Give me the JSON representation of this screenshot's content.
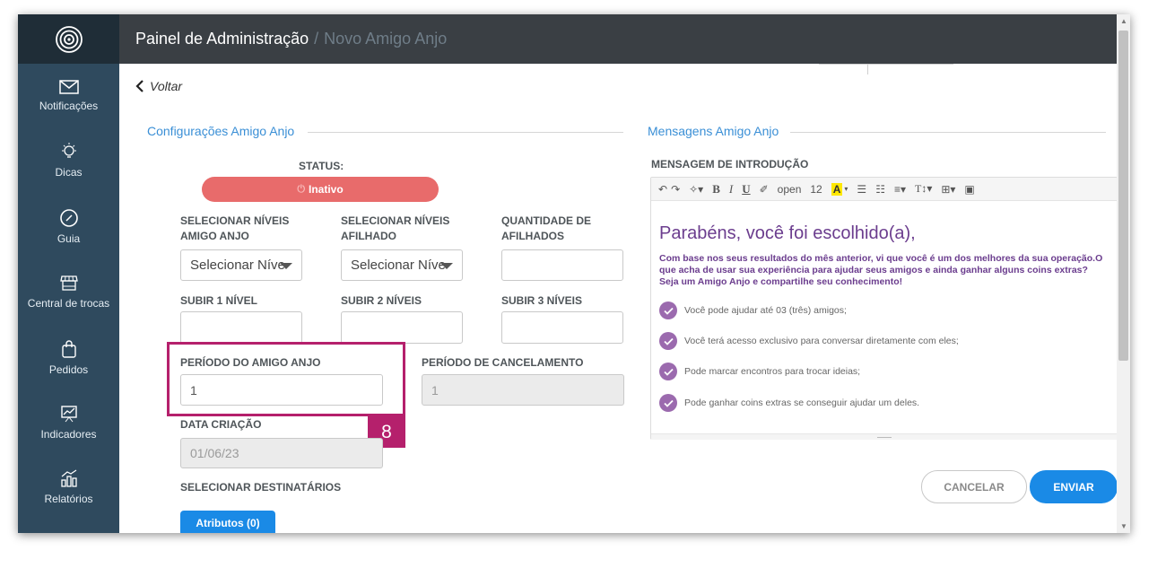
{
  "header": {
    "title": "Painel de Administração",
    "separator": "/",
    "subtitle": "Novo Amigo Anjo"
  },
  "sidebar": {
    "items": [
      {
        "label": "Notificações",
        "icon": "envelope-icon"
      },
      {
        "label": "Dicas",
        "icon": "lightbulb-icon"
      },
      {
        "label": "Guia",
        "icon": "compass-icon"
      },
      {
        "label": "Central de trocas",
        "icon": "store-icon"
      },
      {
        "label": "Pedidos",
        "icon": "shopping-bag-icon"
      },
      {
        "label": "Indicadores",
        "icon": "chart-board-icon"
      },
      {
        "label": "Relatórios",
        "icon": "bar-chart-icon"
      }
    ]
  },
  "nav": {
    "back_label": "Voltar"
  },
  "config": {
    "section_title": "Configurações Amigo Anjo",
    "status_label": "STATUS:",
    "status_value": "Inativo",
    "levels_angel_label": "SELECIONAR NÍVEIS AMIGO ANJO",
    "levels_angel_value": "Selecionar Níve",
    "levels_godchild_label": "SELECIONAR NÍVEIS AFILHADO",
    "levels_godchild_value": "Selecionar Níve",
    "qty_label": "QUANTIDADE DE AFILHADOS",
    "qty_value": "",
    "up1_label": "SUBIR 1 NÍVEL",
    "up1_value": "",
    "up2_label": "SUBIR 2 NÍVEIS",
    "up2_value": "",
    "up3_label": "SUBIR 3 NÍVEIS",
    "up3_value": "",
    "period_label": "PERÍODO DO AMIGO ANJO",
    "period_value": "1",
    "cancel_period_label": "PERÍODO DE CANCELAMENTO",
    "cancel_period_value": "1",
    "created_label": "DATA CRIAÇÃO",
    "created_value": "01/06/23",
    "recipients_label": "SELECIONAR DESTINATÁRIOS",
    "attributes_button": "Atributos (0)",
    "step_badge": "8"
  },
  "messages": {
    "section_title": "Mensagens Amigo Anjo",
    "intro_label": "MENSAGEM DE INTRODUÇÃO",
    "toolbar": {
      "font_name": "open",
      "font_size": "12"
    },
    "title": "Parabéns, você foi escolhido(a),",
    "intro_text": "Com base nos seus resultados do mês anterior, vi que você é um dos melhores da sua operação.O que acha de usar sua experiência para ajudar seus amigos e ainda ganhar alguns coins extras? Seja um Amigo Anjo e compartilhe seu conhecimento!",
    "bullets": [
      "Você pode ajudar até 03 (três) amigos;",
      "Você terá acesso exclusivo para conversar diretamente com eles;",
      "Pode marcar encontros para trocar ideias;",
      "Pode ganhar coins extras se conseguir ajudar um deles."
    ]
  },
  "actions": {
    "cancel_label": "CANCELAR",
    "send_label": "ENVIAR"
  },
  "colors": {
    "sidebar": "#2f4a5e",
    "header": "#3a3f44",
    "accent": "#1a8ae6",
    "status_inactive": "#e86b6b",
    "highlight": "#b5206c",
    "message_purple": "#6b3d8e"
  }
}
